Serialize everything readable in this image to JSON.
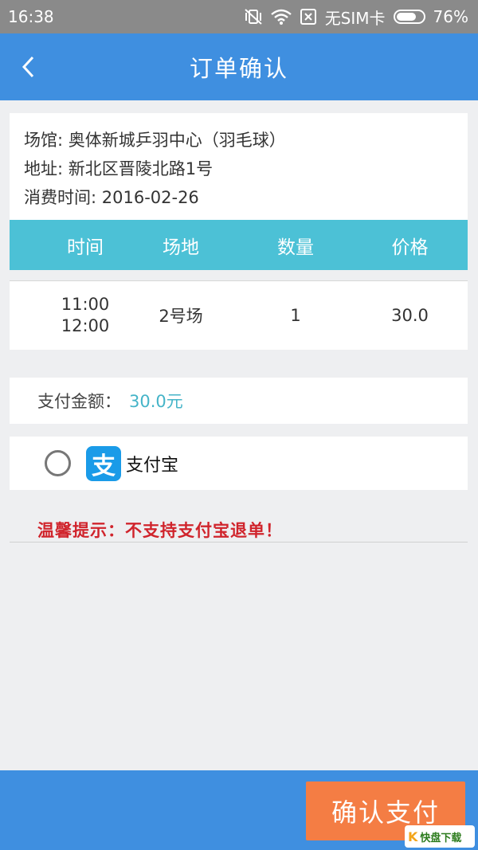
{
  "status_bar": {
    "time": "16:38",
    "carrier": "无SIM卡",
    "battery": "76%",
    "battery_level": 0.76,
    "icons": [
      "vibrate-off-icon",
      "wifi-icon",
      "no-sim-icon",
      "battery-icon"
    ]
  },
  "header": {
    "title": "订单确认",
    "back_icon": "chevron-left-icon"
  },
  "order": {
    "venue": "场馆: 奥体新城乒羽中心（羽毛球）",
    "address": "地址: 新北区晋陵北路1号",
    "date": "消费时间: 2016-02-26"
  },
  "table": {
    "columns": [
      "时间",
      "场地",
      "数量",
      "价格"
    ],
    "rows": [
      {
        "time_start": "11:00",
        "time_end": "12:00",
        "court": "2号场",
        "qty": "1",
        "price": "30.0"
      }
    ]
  },
  "payment": {
    "amount_label": "支付金额：",
    "amount_value": "30.0元",
    "method_name": "支付宝",
    "method_icon_glyph": "支",
    "method_icon": "alipay-logo-icon",
    "selected": false
  },
  "tip": "温馨提示：不支持支付宝退单！",
  "footer": {
    "confirm_label": "确认支付"
  },
  "watermark": {
    "glyph": "K",
    "text": "快盘下载"
  },
  "colors": {
    "header_bg": "#3f8fe0",
    "table_head_bg": "#4cc1d6",
    "amount": "#45b4c8",
    "tip": "#d0242c",
    "confirm_bg": "#f47d44"
  }
}
